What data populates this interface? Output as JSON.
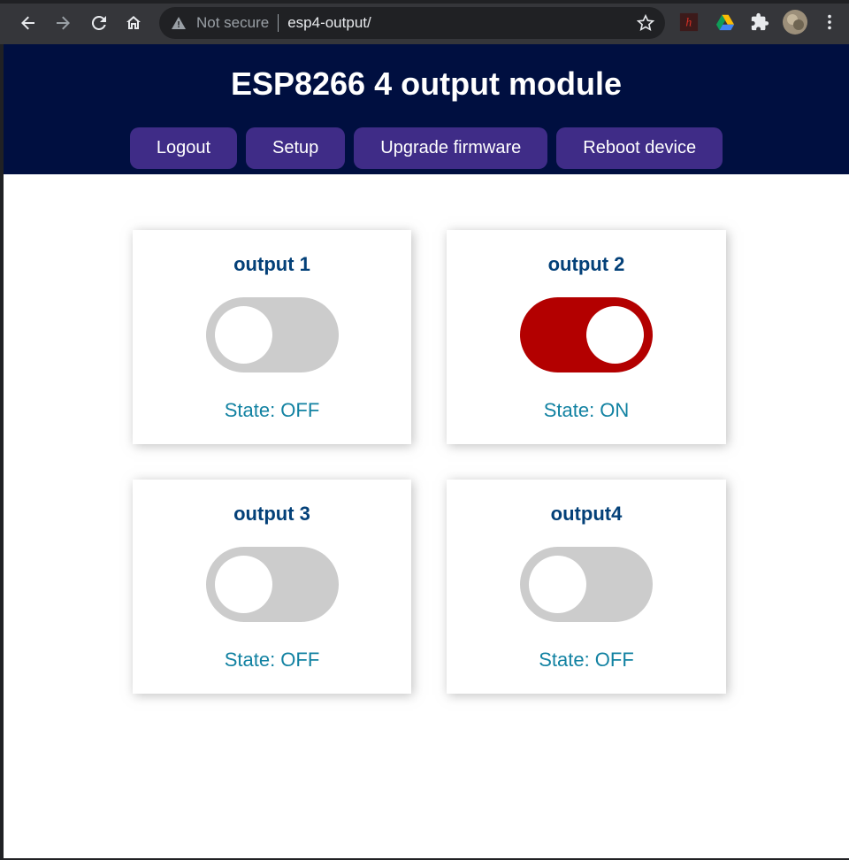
{
  "browser": {
    "security_label": "Not secure",
    "url": "esp4-output/"
  },
  "header": {
    "title": "ESP8266 4 output module"
  },
  "menu": [
    {
      "label": "Logout"
    },
    {
      "label": "Setup"
    },
    {
      "label": "Upgrade firmware"
    },
    {
      "label": "Reboot device"
    }
  ],
  "outputs": [
    {
      "title": "output 1",
      "state": "State: OFF",
      "on": false
    },
    {
      "title": "output 2",
      "state": "State: ON",
      "on": true
    },
    {
      "title": "output 3",
      "state": "State: OFF",
      "on": false
    },
    {
      "title": "output4",
      "state": "State: OFF",
      "on": false
    }
  ],
  "colors": {
    "header_bg": "#000f40",
    "button_bg": "#3f2c87",
    "title_text": "#034078",
    "state_text": "#1282a2",
    "switch_on": "#b30000",
    "switch_off": "#cccccc"
  }
}
